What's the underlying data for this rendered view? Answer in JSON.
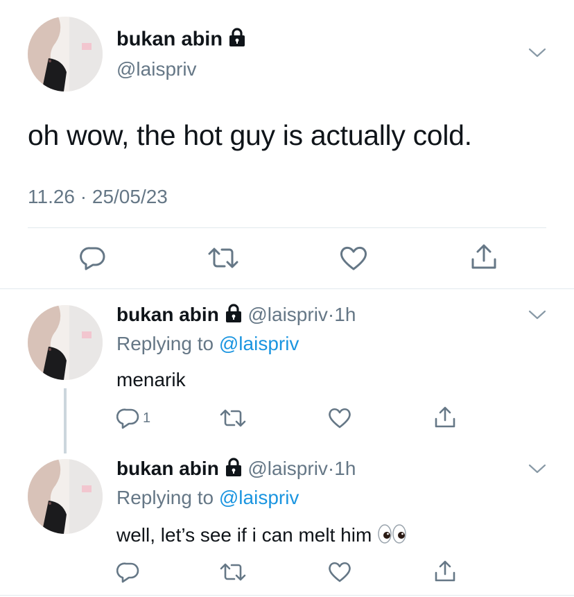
{
  "main_tweet": {
    "display_name": "bukan abin",
    "handle": "@laispriv",
    "text": "oh wow, the hot guy is actually cold.",
    "timestamp": "11.26 · 25/05/23",
    "actions": [
      "reply-icon",
      "retweet-icon",
      "like-icon",
      "share-icon"
    ]
  },
  "replies": [
    {
      "display_name": "bukan abin",
      "handle": "@laispriv",
      "separator": "·",
      "time": "1h",
      "replying_prefix": "Replying to",
      "replying_handle": "@laispriv",
      "text": "menarik",
      "reply_count": "1"
    },
    {
      "display_name": "bukan abin",
      "handle": "@laispriv",
      "separator": "·",
      "time": "1h",
      "replying_prefix": "Replying to",
      "replying_handle": "@laispriv",
      "text": "well, let’s see if i can melt him",
      "emoji": "eyes-emoji"
    }
  ],
  "colors": {
    "link": "#1b95e0",
    "muted": "#657786",
    "divider": "#e1e8ed",
    "thread_line": "#ccd6dd"
  }
}
